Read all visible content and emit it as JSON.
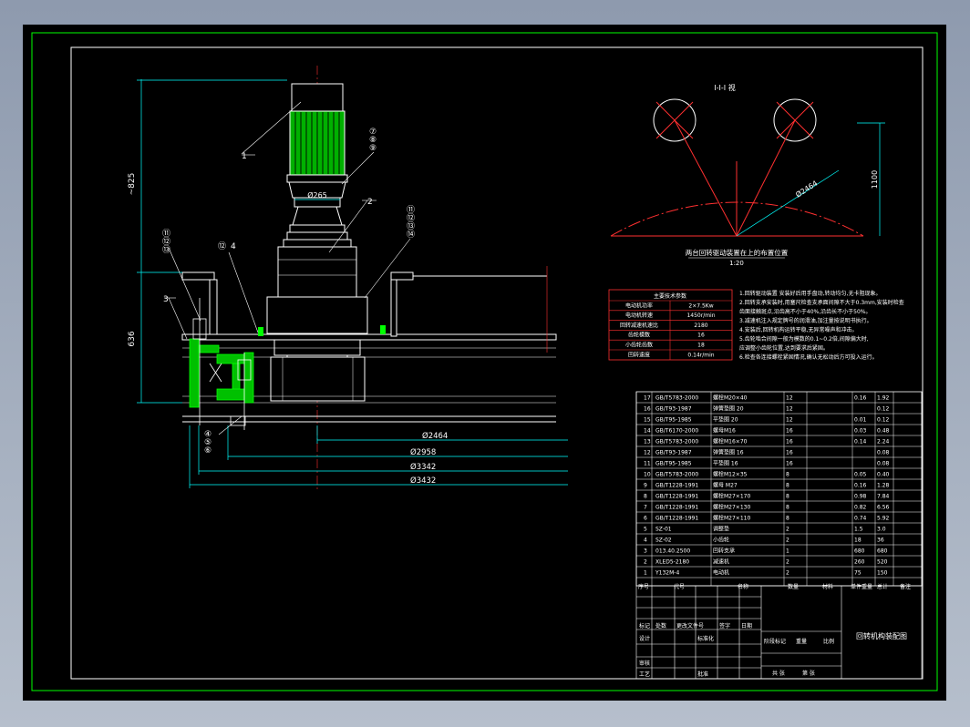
{
  "dimensions": {
    "height_top": "~825",
    "height_lower": "636",
    "motor_flange": "Ø265",
    "diameters": [
      "Ø2464",
      "Ø2958",
      "Ø3342",
      "Ø3432"
    ]
  },
  "leaders": {
    "left_top": [
      "⑪",
      "⑫",
      "⑬"
    ],
    "right_top": [
      "⑦",
      "⑧",
      "⑨"
    ],
    "right_mid": [
      "⑪",
      "⑫",
      "⑬",
      "⑭"
    ],
    "mid": "⑫",
    "bottom": [
      "④",
      "⑤",
      "⑥"
    ],
    "parts": [
      "1",
      "2",
      "3",
      "4",
      "5"
    ]
  },
  "detail_view": {
    "title": "I-I-I 视",
    "dim_height": "1100",
    "dim_dia": "Ø2464",
    "caption": "两台回转驱动装置在上的布置位置",
    "scale": "1:20"
  },
  "tech_table": {
    "header": "主要技术参数",
    "rows": [
      [
        "电动机功率",
        "2×7.5Kw"
      ],
      [
        "电动机转速",
        "1450r/min"
      ],
      [
        "回转减速机速比",
        "2180"
      ],
      [
        "齿轮模数",
        "16"
      ],
      [
        "小齿轮齿数",
        "18"
      ],
      [
        "回转速度",
        "0.14r/min"
      ]
    ]
  },
  "notes": [
    "1.回转驱动装置  安装好后用手盘动,转动均匀,无卡阻现象。",
    "2.回转支承安装时,用塞尺检查支承面间隙不大于0.3mm,安装时检查",
    "  齿面接触斑点,沿齿高不小于40%,沿齿长不小于50%。",
    "3.减速机注入规定牌号的润滑油,加注量按说明书执行。",
    "4.安装后,回转机构运转平稳,无异常噪声和冲击。",
    "5.齿轮啮合间隙一般为模数的0.1~0.2倍,间隙偏大时,",
    "  应调整小齿轮位置,达到要求后紧固。",
    "6.检查各连接螺栓紧固情况,确认无松动后方可投入运行。"
  ],
  "parts_list": {
    "rows": [
      [
        "17",
        "GB/T5783-2000",
        "螺栓M20×40",
        "12",
        "",
        "0.16",
        "1.92"
      ],
      [
        "16",
        "GB/T93-1987",
        "弹簧垫圈 20",
        "12",
        "",
        "",
        "0.12"
      ],
      [
        "15",
        "GB/T95-1985",
        "平垫圈 20",
        "12",
        "",
        "0.01",
        "0.12"
      ],
      [
        "14",
        "GB/T6170-2000",
        "螺母M16",
        "16",
        "",
        "0.03",
        "0.48"
      ],
      [
        "13",
        "GB/T5783-2000",
        "螺栓M16×70",
        "16",
        "",
        "0.14",
        "2.24"
      ],
      [
        "12",
        "GB/T93-1987",
        "弹簧垫圈 16",
        "16",
        "",
        "",
        "0.08"
      ],
      [
        "11",
        "GB/T95-1985",
        "平垫圈 16",
        "16",
        "",
        "",
        "0.08"
      ],
      [
        "10",
        "GB/T5783-2000",
        "螺栓M12×35",
        "8",
        "",
        "0.05",
        "0.40"
      ],
      [
        "9",
        "GB/T1228-1991",
        "螺母 M27",
        "8",
        "",
        "0.16",
        "1.28"
      ],
      [
        "8",
        "GB/T1228-1991",
        "螺栓M27×170",
        "8",
        "",
        "0.98",
        "7.84"
      ],
      [
        "7",
        "GB/T1228-1991",
        "螺栓M27×130",
        "8",
        "",
        "0.82",
        "6.56"
      ],
      [
        "6",
        "GB/T1228-1991",
        "螺栓M27×110",
        "8",
        "",
        "0.74",
        "5.92"
      ],
      [
        "5",
        "SZ-01",
        "调整垫",
        "2",
        "",
        "1.5",
        "3.0"
      ],
      [
        "4",
        "SZ-02",
        "小齿轮",
        "2",
        "",
        "18",
        "36"
      ],
      [
        "3",
        "013.40.2500",
        "回转支承",
        "1",
        "",
        "680",
        "680"
      ],
      [
        "2",
        "XLED5-2180",
        "减速机",
        "2",
        "",
        "260",
        "520"
      ],
      [
        "1",
        "Y132M-4",
        "电动机",
        "2",
        "",
        "75",
        "150"
      ]
    ],
    "header": [
      "序号",
      "代号",
      "名称",
      "数量",
      "材料",
      "单件重量",
      "总计",
      "备注"
    ]
  },
  "title_block": {
    "drawing_name": "回转机构装配图",
    "labels_left": [
      "标记",
      "处数",
      "更改文件号",
      "签字",
      "日期"
    ],
    "labels_rows": [
      "设计",
      "审核",
      "工艺"
    ],
    "labels_mid": [
      "标准化",
      "批准",
      "阶段标记",
      "重量",
      "比例"
    ],
    "labels_bottom": [
      "共 张",
      "第 张"
    ]
  }
}
